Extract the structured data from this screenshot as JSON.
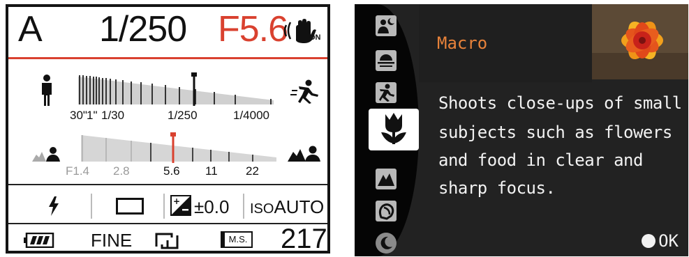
{
  "status_display": {
    "mode": "A",
    "shutter_speed": "1/250",
    "aperture": "F5.6",
    "steadyshot_badge": "ON",
    "shutter_scale": {
      "left_icon": "person-standing-icon",
      "right_icon": "person-running-icon",
      "labels": [
        "30\"",
        "1\"",
        "1/30",
        "1/250",
        "1/4000"
      ],
      "current_label": "1/250"
    },
    "aperture_scale": {
      "left_icon": "blurred-background-portrait-icon",
      "right_icon": "sharp-background-portrait-icon",
      "labels": [
        "F1.4",
        "2.8",
        "5.6",
        "11",
        "22"
      ],
      "current_label": "5.6"
    },
    "flash_icon": "flash-icon",
    "drive_icon": "single-shot-icon",
    "exposure_comp": "±0.0",
    "iso": "AUTO",
    "iso_prefix": "ISO",
    "battery_icon": "battery-icon",
    "quality": "FINE",
    "aspect_icon": "aspect-ratio-icon",
    "media_label": "M.S.",
    "shots_remaining": "217",
    "colors": {
      "accent": "#d9412f",
      "text": "#111111"
    }
  },
  "scene_menu": {
    "scene_name": "Macro",
    "description_lines": [
      "Shoots close-ups of small",
      "subjects such as flowers",
      "and food in clear and",
      "sharp focus."
    ],
    "ok_label": "OK",
    "icons": [
      "night-portrait-icon",
      "sunset-icon",
      "sports-icon",
      "macro-icon",
      "landscape-icon",
      "portrait-icon",
      "night-view-icon"
    ],
    "selected_icon": "macro-icon",
    "colors": {
      "title": "#e8823a",
      "text": "#f2f2f2",
      "background": "#222222"
    }
  }
}
